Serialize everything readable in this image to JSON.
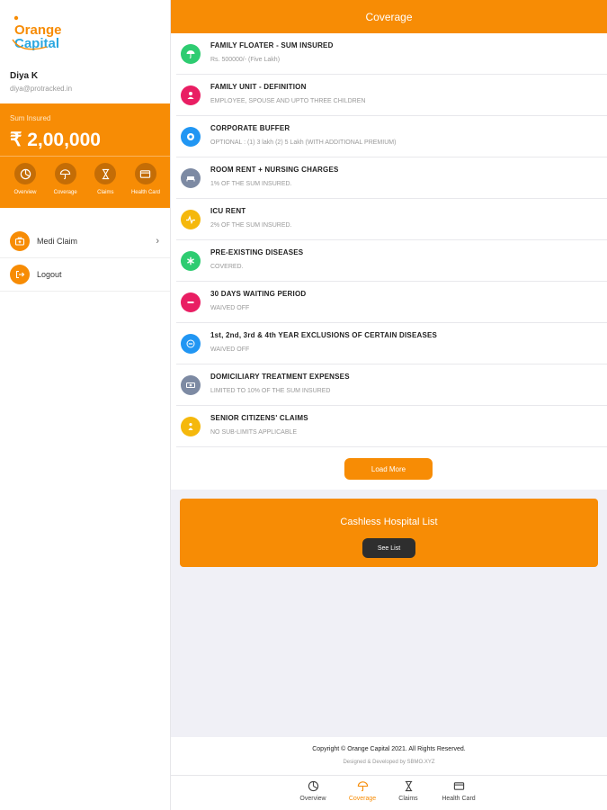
{
  "brand": {
    "logo_line1": "Orange",
    "logo_line2": "Capital",
    "accent": "#f78c05",
    "accent_dark": "#c46d06"
  },
  "user": {
    "name": "Diya K",
    "email": "diya@protracked.in"
  },
  "sum_insured": {
    "label": "Sum Insured",
    "value": "₹ 2,00,000"
  },
  "quick_actions": [
    {
      "label": "Overview",
      "icon": "pie-chart-icon"
    },
    {
      "label": "Coverage",
      "icon": "umbrella-icon"
    },
    {
      "label": "Claims",
      "icon": "hourglass-icon"
    },
    {
      "label": "Health Card",
      "icon": "card-icon"
    }
  ],
  "sidebar_menu": [
    {
      "label": "Medi Claim",
      "icon": "briefcase-icon",
      "has_chevron": true
    },
    {
      "label": "Logout",
      "icon": "logout-icon",
      "has_chevron": false
    }
  ],
  "page": {
    "title": "Coverage"
  },
  "coverage_items": [
    {
      "title": "FAMILY FLOATER - SUM INSURED",
      "subtitle": "Rs. 500000/- (Five Lakh)",
      "icon": "umbrella-icon",
      "color": "#2ecc71"
    },
    {
      "title": "FAMILY UNIT - DEFINITION",
      "subtitle": "EMPLOYEE, SPOUSE AND UPTO THREE CHILDREN",
      "icon": "family-icon",
      "color": "#e91e63"
    },
    {
      "title": "CORPORATE BUFFER",
      "subtitle": "OPTIONAL : (1) 3 lakh (2) 5 Lakh (WITH ADDITIONAL PREMIUM)",
      "icon": "buffer-icon",
      "color": "#2196f3"
    },
    {
      "title": "ROOM RENT + NURSING CHARGES",
      "subtitle": "1% OF THE SUM INSURED.",
      "icon": "bed-icon",
      "color": "#7d8aa3"
    },
    {
      "title": "ICU RENT",
      "subtitle": "2% OF THE SUM INSURED.",
      "icon": "pulse-icon",
      "color": "#f5b80c"
    },
    {
      "title": "PRE-EXISTING DISEASES",
      "subtitle": "COVERED.",
      "icon": "asterisk-icon",
      "color": "#2ecc71"
    },
    {
      "title": "30 DAYS WAITING PERIOD",
      "subtitle": "WAIVED OFF",
      "icon": "minus-circle-icon",
      "color": "#e91e63"
    },
    {
      "title": "1st, 2nd, 3rd & 4th YEAR EXCLUSIONS OF CERTAIN DISEASES",
      "subtitle": "WAIVED OFF",
      "icon": "minus-icon",
      "color": "#2196f3"
    },
    {
      "title": "DOMICILIARY TREATMENT EXPENSES",
      "subtitle": "LIMITED TO 10% OF THE SUM INSURED",
      "icon": "money-icon",
      "color": "#7d8aa3"
    },
    {
      "title": "SENIOR CITIZENS' CLAIMS",
      "subtitle": "NO SUB-LIMITS APPLICABLE",
      "icon": "senior-icon",
      "color": "#f5b80c"
    }
  ],
  "load_more": {
    "label": "Load More"
  },
  "cashless": {
    "title": "Cashless Hospital List",
    "button": "See List"
  },
  "footer": {
    "copyright": "Copyright © Orange Capital 2021. All Rights Reserved.",
    "designed": "Designed & Developed by SBMO.XYZ"
  },
  "bottom_nav": [
    {
      "label": "Overview",
      "icon": "pie-chart-icon",
      "active": false
    },
    {
      "label": "Coverage",
      "icon": "umbrella-icon",
      "active": true
    },
    {
      "label": "Claims",
      "icon": "hourglass-icon",
      "active": false
    },
    {
      "label": "Health Card",
      "icon": "card-icon",
      "active": false
    }
  ]
}
